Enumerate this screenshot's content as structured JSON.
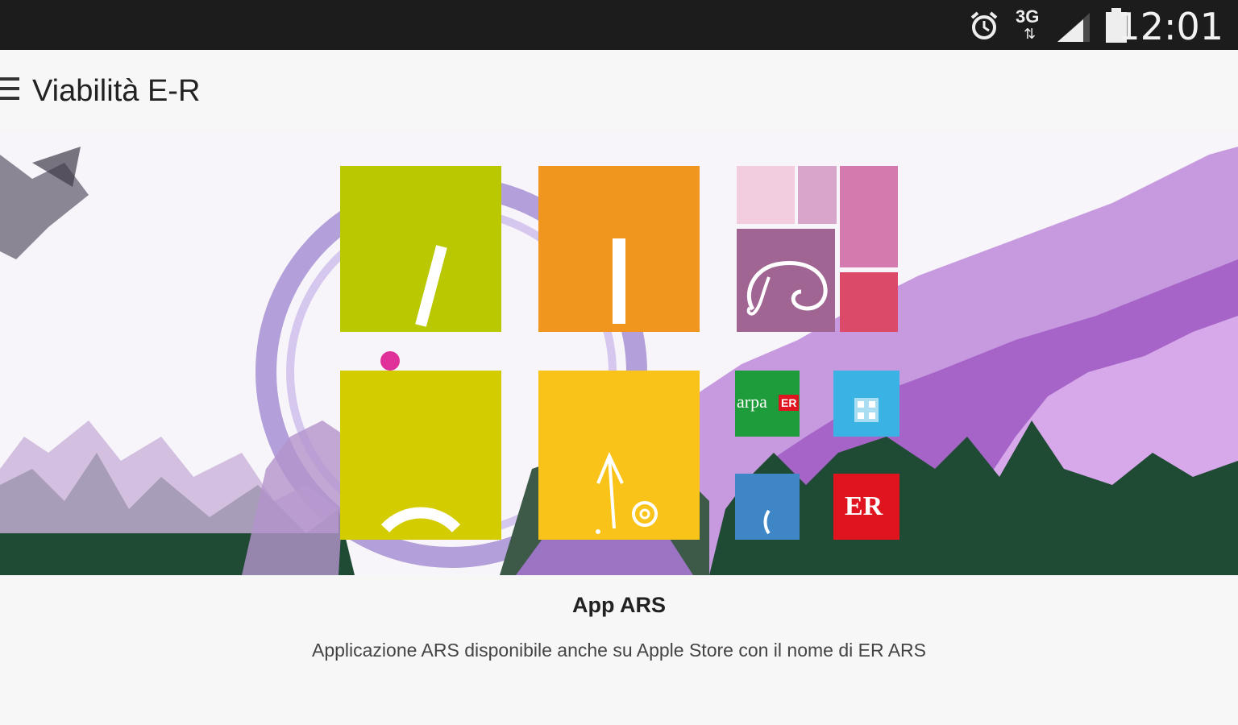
{
  "status_bar": {
    "time": "12:01",
    "network_label": "3G",
    "icons": [
      "alarm-icon",
      "network-3g-icon",
      "signal-icon",
      "battery-icon"
    ]
  },
  "app_bar": {
    "title": "Viabilità E-R",
    "menu_icon": "hamburger-menu-icon"
  },
  "banner": {
    "tiles": [
      {
        "name": "green-tile",
        "color": "#b9c800",
        "icon": "slash-glyph-icon"
      },
      {
        "name": "orange-tile",
        "color": "#f0961e",
        "icon": "bar-glyph-icon"
      },
      {
        "name": "pink-mosaic-tile",
        "colors": [
          "#f2cde0",
          "#d9a6cb",
          "#d47aae",
          "#a06592",
          "#dc4a6a"
        ],
        "icon": "elephant-swirl-icon"
      },
      {
        "name": "yellow-green-tile",
        "color": "#d2cc00",
        "icon": "arc-glyph-icon"
      },
      {
        "name": "yellow-tile",
        "color": "#fac31a",
        "icon": "arrow-at-glyph-icon"
      },
      {
        "name": "arpa-tile",
        "color": "#1e9b3a",
        "label": "arpa",
        "badge": "ER"
      },
      {
        "name": "qr-tile",
        "color": "#3ab3e4",
        "icon": "qr-code-icon"
      },
      {
        "name": "blue-tile",
        "color": "#3f86c6",
        "icon": "parenthesis-glyph-icon"
      },
      {
        "name": "er-tile",
        "color": "#e0141e",
        "label": "ER"
      }
    ]
  },
  "caption": {
    "title": "App ARS",
    "description": "Applicazione ARS disponibile anche su Apple Store con il nome di ER ARS"
  },
  "colors": {
    "status_bar": "#1c1c1c",
    "app_bar": "#f7f7f7",
    "foliage_purple": "#b77fd0",
    "foliage_green": "#1f4a34"
  }
}
